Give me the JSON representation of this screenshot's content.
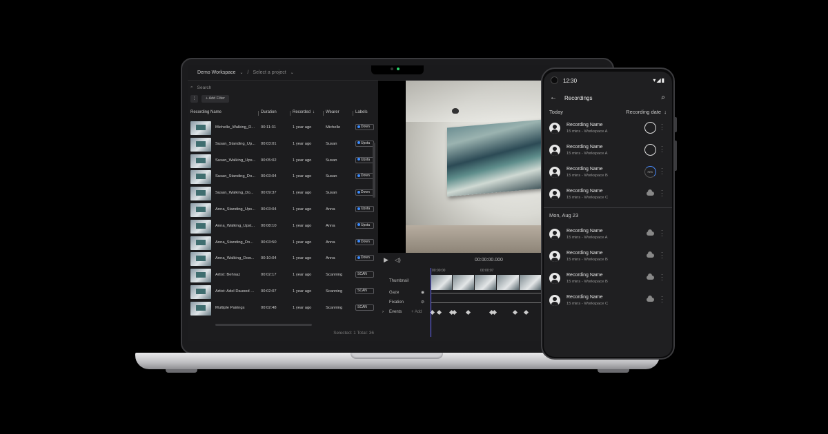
{
  "desktop": {
    "workspace": "Demo Workspace",
    "breadcrumb_sep": "/",
    "project_placeholder": "Select a project",
    "search_placeholder": "Search",
    "more_label": "⋮",
    "add_filter": "Add Filter",
    "columns": [
      "Recording Name",
      "Duration",
      "Recorded",
      "Wearer",
      "Labels"
    ],
    "sort_indicator": "↓",
    "rows": [
      {
        "name": "Michelle_Walking_D...",
        "duration": "00:11:31",
        "recorded": "1 year ago",
        "wearer": "Michelle",
        "label": "Down"
      },
      {
        "name": "Susan_Standing_Up...",
        "duration": "00:03:01",
        "recorded": "1 year ago",
        "wearer": "Susan",
        "label": "Upsta"
      },
      {
        "name": "Susan_Walking_Ups...",
        "duration": "00:05:02",
        "recorded": "1 year ago",
        "wearer": "Susan",
        "label": "Upsta"
      },
      {
        "name": "Susan_Standing_Do...",
        "duration": "00:03:04",
        "recorded": "1 year ago",
        "wearer": "Susan",
        "label": "Down"
      },
      {
        "name": "Susan_Walking_Do...",
        "duration": "00:09:37",
        "recorded": "1 year ago",
        "wearer": "Susan",
        "label": "Down"
      },
      {
        "name": "Anna_Standing_Ups...",
        "duration": "00:03:04",
        "recorded": "1 year ago",
        "wearer": "Anna",
        "label": "Upsta"
      },
      {
        "name": "Anna_Walking_Upst...",
        "duration": "00:08:10",
        "recorded": "1 year ago",
        "wearer": "Anna",
        "label": "Upsta"
      },
      {
        "name": "Anna_Standing_Do...",
        "duration": "00:03:50",
        "recorded": "1 year ago",
        "wearer": "Anna",
        "label": "Down"
      },
      {
        "name": "Anna_Walking_Dow...",
        "duration": "00:10:04",
        "recorded": "1 year ago",
        "wearer": "Anna",
        "label": "Down"
      },
      {
        "name": "Artist: Behnaz",
        "duration": "00:02:17",
        "recorded": "1 year ago",
        "wearer": "Scanning",
        "label": "SCAN"
      },
      {
        "name": "Artist: Adel Dauood ...",
        "duration": "00:02:07",
        "recorded": "1 year ago",
        "wearer": "Scanning",
        "label": "SCAN"
      },
      {
        "name": "Multiple Pairings",
        "duration": "00:02:48",
        "recorded": "1 year ago",
        "wearer": "Scanning",
        "label": "SCAN"
      }
    ],
    "footer": "Selected: 1  Total: 36",
    "timecode": "00:00:00.000",
    "timeline_labels": {
      "thumbnail": "Thumbnail",
      "gaze": "Gaze",
      "fixation": "Fixation",
      "events": "Events",
      "add": "Add"
    },
    "tick_a": "00:00:00",
    "tick_b": "00:00:07"
  },
  "phone": {
    "time": "12:30",
    "title": "Recordings",
    "section_today": "Today",
    "sort_label": "Recording date",
    "section_aug": "Mon, Aug 23",
    "items_today": [
      {
        "name": "Recording Name",
        "sub": "15 mins - Workspace A",
        "state": "ring"
      },
      {
        "name": "Recording Name",
        "sub": "15 mins - Workspace A",
        "state": "ring"
      },
      {
        "name": "Recording Name",
        "sub": "15 mins - Workspace B",
        "state": "progress",
        "progress": "75%"
      },
      {
        "name": "Recording Name",
        "sub": "15 mins - Workspace C",
        "state": "cloud"
      }
    ],
    "items_aug": [
      {
        "name": "Recording Name",
        "sub": "15 mins - Workspace A",
        "state": "cloud"
      },
      {
        "name": "Recording Name",
        "sub": "15 mins - Workspace B",
        "state": "cloud"
      },
      {
        "name": "Recording Name",
        "sub": "15 mins - Workspace B",
        "state": "cloud"
      },
      {
        "name": "Recording Name",
        "sub": "15 mins - Workspace C",
        "state": "cloud"
      }
    ]
  }
}
